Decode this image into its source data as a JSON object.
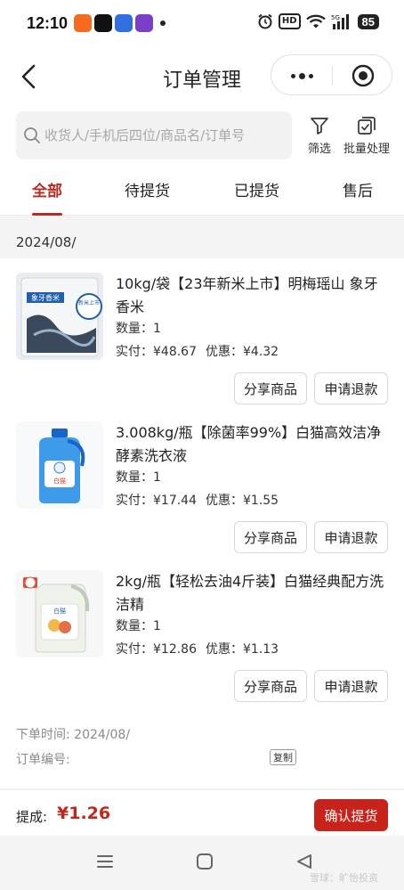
{
  "status_bar": {
    "time": "12:10",
    "hd": "HD",
    "battery": "85"
  },
  "header": {
    "title": "订单管理"
  },
  "search": {
    "placeholder": "收货人/手机后四位/商品名/订单号"
  },
  "tools": {
    "filter": "筛选",
    "batch": "批量处理"
  },
  "tabs": [
    {
      "label": "全部",
      "active": true
    },
    {
      "label": "待提货",
      "active": false
    },
    {
      "label": "已提货",
      "active": false
    },
    {
      "label": "售后",
      "active": false
    }
  ],
  "order": {
    "date": "2024/08/",
    "items": [
      {
        "title": "10kg/袋【23年新米上市】明梅瑶山 象牙香米",
        "qty": "数量：1",
        "paid": "实付：¥48.67",
        "discount": "优惠：¥4.32",
        "share_label": "分享商品",
        "refund_label": "申请退款",
        "thumb_text": "象牙香米",
        "thumb_badge": "新米上市"
      },
      {
        "title": "3.008kg/瓶【除菌率99%】白猫高效洁净酵素洗衣液",
        "qty": "数量：1",
        "paid": "实付：¥17.44",
        "discount": "优惠：¥1.55",
        "share_label": "分享商品",
        "refund_label": "申请退款",
        "thumb_text": "白猫"
      },
      {
        "title": "2kg/瓶【轻松去油4斤装】白猫经典配方洗洁精",
        "qty": "数量：1",
        "paid": "实付：¥12.86",
        "discount": "优惠：¥1.13",
        "share_label": "分享商品",
        "refund_label": "申请退款",
        "thumb_text": "白猫"
      }
    ],
    "order_time": "下单时间: 2024/08/",
    "order_no": "订单编号:",
    "copy_label": "复制"
  },
  "bottom": {
    "commission_label": "提成:",
    "commission_value": "¥1.26",
    "confirm_label": "确认提货"
  },
  "watermark": "雪球：旷怡投资",
  "colors": {
    "accent": "#c0281d",
    "confirm": "#c7231a",
    "background": "#f4f4f4"
  }
}
